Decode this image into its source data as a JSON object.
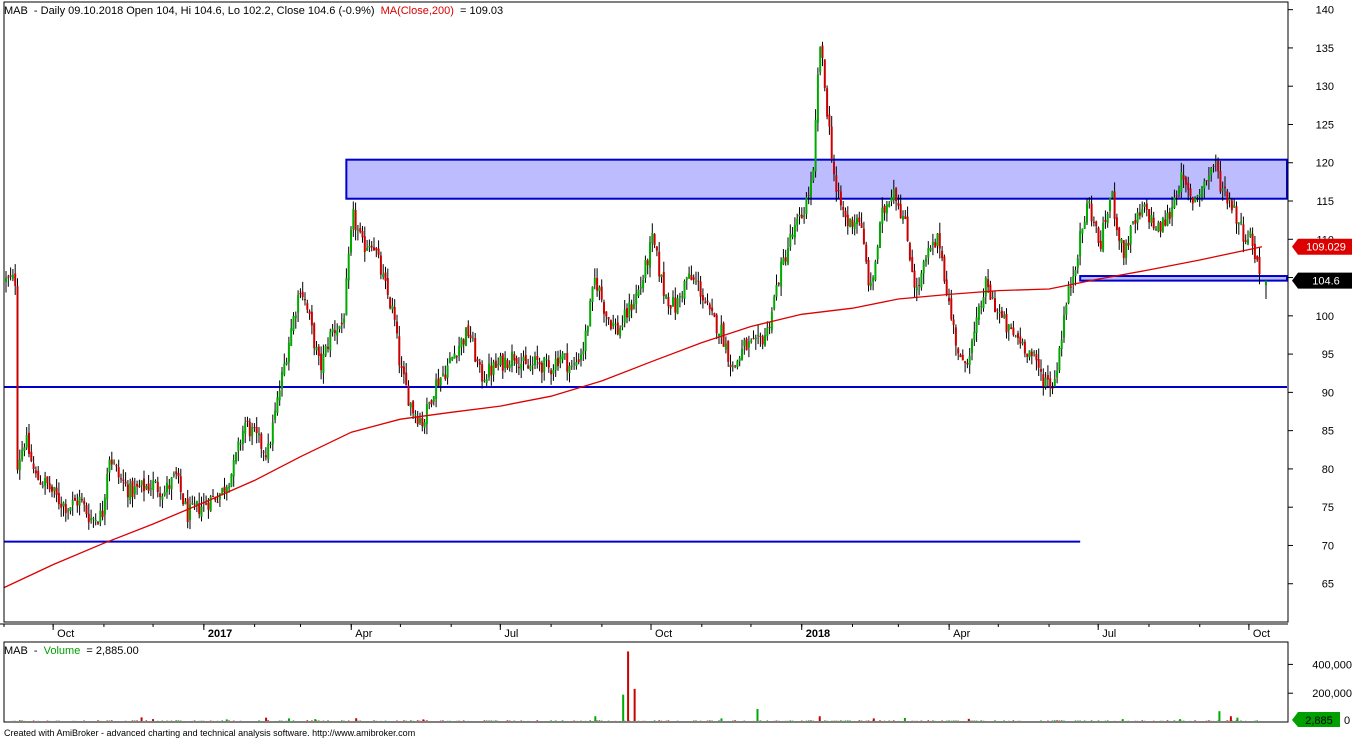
{
  "header": {
    "symbol": "MAB",
    "title_info": "- Daily 09.10.2018 Open 104, Hi 104.6, Lo 102.2, Close 104.6 (-0.9%)",
    "ma_label": "MA(Close,200)",
    "ma_value": "= 109.03"
  },
  "volume_header": {
    "symbol": "MAB",
    "dash": "-",
    "label": "Volume",
    "value": "= 2,885.00"
  },
  "footer": "Created with AmiBroker - advanced charting and technical analysis software. http://www.amibroker.com",
  "colors": {
    "up": "#00aa00",
    "down": "#cc0000",
    "wick": "#000000",
    "ma": "#dd0000",
    "level": "#0000cc",
    "zone_fill": "#b8b8ff",
    "volume_label": "#00a000"
  },
  "chart_data": [
    {
      "type": "candlestick",
      "symbol": "MAB",
      "period": "Daily",
      "last_bar": {
        "date": "09.10.2018",
        "open": 104,
        "high": 104.6,
        "low": 102.2,
        "close": 104.6,
        "change_pct": -0.9
      },
      "y_axis": {
        "range": [
          60,
          141
        ],
        "ticks": [
          65,
          70,
          75,
          80,
          85,
          90,
          95,
          100,
          105,
          110,
          115,
          120,
          125,
          130,
          135,
          140
        ]
      },
      "x_axis": {
        "labels": [
          "Oct",
          "2017",
          "Apr",
          "Jul",
          "Oct",
          "2018",
          "Apr",
          "Jul",
          "Oct"
        ],
        "bold": [
          "2017",
          "2018"
        ]
      },
      "close_path": [
        [
          "2016-09-08",
          80
        ],
        [
          "2016-09-14",
          84
        ],
        [
          "2016-09-20",
          79
        ],
        [
          "2016-09-27",
          78
        ],
        [
          "2016-10-04",
          76
        ],
        [
          "2016-10-10",
          75
        ],
        [
          "2016-10-17",
          76
        ],
        [
          "2016-10-24",
          73.5
        ],
        [
          "2016-10-31",
          74
        ],
        [
          "2016-11-04",
          82
        ],
        [
          "2016-11-10",
          79
        ],
        [
          "2016-11-17",
          77
        ],
        [
          "2016-11-24",
          77.5
        ],
        [
          "2016-12-01",
          78
        ],
        [
          "2016-12-08",
          77
        ],
        [
          "2016-12-15",
          79
        ],
        [
          "2016-12-22",
          74
        ],
        [
          "2016-12-29",
          75
        ],
        [
          "2017-01-05",
          76
        ],
        [
          "2017-01-12",
          77
        ],
        [
          "2017-01-19",
          80
        ],
        [
          "2017-01-26",
          86
        ],
        [
          "2017-02-02",
          84
        ],
        [
          "2017-02-09",
          82
        ],
        [
          "2017-02-16",
          90
        ],
        [
          "2017-02-23",
          98
        ],
        [
          "2017-03-01",
          104
        ],
        [
          "2017-03-06",
          100
        ],
        [
          "2017-03-13",
          93
        ],
        [
          "2017-03-20",
          98
        ],
        [
          "2017-03-27",
          99
        ],
        [
          "2017-04-02",
          113
        ],
        [
          "2017-04-08",
          109
        ],
        [
          "2017-04-14",
          110
        ],
        [
          "2017-04-20",
          105
        ],
        [
          "2017-04-27",
          100
        ],
        [
          "2017-05-01",
          93
        ],
        [
          "2017-05-08",
          88
        ],
        [
          "2017-05-15",
          86
        ],
        [
          "2017-05-22",
          91
        ],
        [
          "2017-05-29",
          93
        ],
        [
          "2017-06-05",
          96
        ],
        [
          "2017-06-12",
          98
        ],
        [
          "2017-06-19",
          92
        ],
        [
          "2017-06-26",
          93
        ],
        [
          "2017-07-03",
          94
        ],
        [
          "2017-07-10",
          95
        ],
        [
          "2017-07-17",
          93
        ],
        [
          "2017-07-24",
          94
        ],
        [
          "2017-07-31",
          93
        ],
        [
          "2017-08-07",
          95
        ],
        [
          "2017-08-14",
          93
        ],
        [
          "2017-08-21",
          96
        ],
        [
          "2017-08-28",
          105
        ],
        [
          "2017-09-04",
          100
        ],
        [
          "2017-09-11",
          98
        ],
        [
          "2017-09-18",
          101
        ],
        [
          "2017-09-25",
          104
        ],
        [
          "2017-10-02",
          110
        ],
        [
          "2017-10-09",
          103
        ],
        [
          "2017-10-16",
          101
        ],
        [
          "2017-10-23",
          105
        ],
        [
          "2017-10-30",
          104
        ],
        [
          "2017-11-06",
          100
        ],
        [
          "2017-11-13",
          98
        ],
        [
          "2017-11-20",
          93
        ],
        [
          "2017-11-27",
          96
        ],
        [
          "2017-12-04",
          96
        ],
        [
          "2017-12-11",
          98
        ],
        [
          "2017-12-18",
          105
        ],
        [
          "2017-12-25",
          110
        ],
        [
          "2018-01-01",
          113
        ],
        [
          "2018-01-08",
          118
        ],
        [
          "2018-01-12",
          136
        ],
        [
          "2018-01-16",
          128
        ],
        [
          "2018-01-22",
          116
        ],
        [
          "2018-01-29",
          112
        ],
        [
          "2018-02-05",
          113
        ],
        [
          "2018-02-12",
          103
        ],
        [
          "2018-02-19",
          113
        ],
        [
          "2018-02-26",
          117
        ],
        [
          "2018-03-05",
          112
        ],
        [
          "2018-03-12",
          103
        ],
        [
          "2018-03-19",
          108
        ],
        [
          "2018-03-26",
          110
        ],
        [
          "2018-04-02",
          100
        ],
        [
          "2018-04-09",
          93
        ],
        [
          "2018-04-16",
          97
        ],
        [
          "2018-04-23",
          104
        ],
        [
          "2018-04-30",
          101
        ],
        [
          "2018-05-07",
          98
        ],
        [
          "2018-05-14",
          97
        ],
        [
          "2018-05-21",
          95
        ],
        [
          "2018-05-28",
          92
        ],
        [
          "2018-06-04",
          91
        ],
        [
          "2018-06-11",
          101
        ],
        [
          "2018-06-18",
          108
        ],
        [
          "2018-06-25",
          115
        ],
        [
          "2018-07-02",
          109
        ],
        [
          "2018-07-09",
          116
        ],
        [
          "2018-07-16",
          108
        ],
        [
          "2018-07-23",
          112
        ],
        [
          "2018-07-30",
          114
        ],
        [
          "2018-08-06",
          111
        ],
        [
          "2018-08-13",
          113
        ],
        [
          "2018-08-20",
          118
        ],
        [
          "2018-08-27",
          115
        ],
        [
          "2018-09-03",
          117
        ],
        [
          "2018-09-10",
          120
        ],
        [
          "2018-09-14",
          117
        ],
        [
          "2018-09-20",
          115
        ],
        [
          "2018-09-27",
          111
        ],
        [
          "2018-10-03",
          110
        ],
        [
          "2018-10-08",
          105
        ],
        [
          "2018-10-09",
          104.6
        ]
      ],
      "series": [
        {
          "name": "MA(Close,200)",
          "type": "line",
          "last_value": 109.03,
          "points": [
            [
              "2016-09-01",
              64.5
            ],
            [
              "2016-10-01",
              67.5
            ],
            [
              "2016-11-01",
              70.3
            ],
            [
              "2016-12-01",
              72.8
            ],
            [
              "2017-01-01",
              75.6
            ],
            [
              "2017-02-01",
              78.5
            ],
            [
              "2017-03-01",
              81.6
            ],
            [
              "2017-04-01",
              84.8
            ],
            [
              "2017-05-01",
              86.5
            ],
            [
              "2017-06-01",
              87.4
            ],
            [
              "2017-07-01",
              88.2
            ],
            [
              "2017-08-01",
              89.5
            ],
            [
              "2017-09-01",
              91.5
            ],
            [
              "2017-10-01",
              94.0
            ],
            [
              "2017-11-01",
              96.5
            ],
            [
              "2017-12-01",
              98.6
            ],
            [
              "2018-01-01",
              100.2
            ],
            [
              "2018-02-01",
              101.0
            ],
            [
              "2018-03-01",
              102.2
            ],
            [
              "2018-04-01",
              102.8
            ],
            [
              "2018-05-01",
              103.3
            ],
            [
              "2018-06-01",
              103.5
            ],
            [
              "2018-07-01",
              104.8
            ],
            [
              "2018-08-01",
              106.0
            ],
            [
              "2018-09-01",
              107.3
            ],
            [
              "2018-10-09",
              109.03
            ]
          ]
        }
      ],
      "price_tags": [
        {
          "label": "109.029",
          "value": 109.03,
          "color": "#dd0000"
        },
        {
          "label": "104.6",
          "value": 104.6,
          "color": "#000000"
        }
      ],
      "annotations": [
        {
          "type": "zone",
          "from": "2017-03-29",
          "to": "2018-10-09",
          "bottom": 115.3,
          "top": 120.4
        },
        {
          "type": "zone",
          "from": "2018-06-20",
          "to": "2018-10-09",
          "bottom": 104.6,
          "top": 105.2
        },
        {
          "type": "hline",
          "value": 90.7,
          "from": "2016-09-01",
          "to": "2018-10-09"
        },
        {
          "type": "hline",
          "value": 70.5,
          "from": "2016-09-01",
          "to": "2018-06-20"
        }
      ]
    },
    {
      "type": "bar",
      "name": "Volume",
      "y_axis": {
        "range": [
          0,
          500000
        ],
        "ticks": [
          {
            "value": 200000,
            "label": "200,000"
          },
          {
            "value": 400000,
            "label": "400,000"
          }
        ]
      },
      "last_value": 2885,
      "last_value_label": "2,885",
      "baseline": 8000,
      "spikes": [
        [
          "2016-11-24",
          32000,
          "down"
        ],
        [
          "2016-12-01",
          20000,
          "down"
        ],
        [
          "2017-01-15",
          18000,
          "up"
        ],
        [
          "2017-02-08",
          30000,
          "down"
        ],
        [
          "2017-02-22",
          25000,
          "up"
        ],
        [
          "2017-03-10",
          20000,
          "up"
        ],
        [
          "2017-04-04",
          26000,
          "down"
        ],
        [
          "2017-05-15",
          18000,
          "down"
        ],
        [
          "2017-08-28",
          40000,
          "up"
        ],
        [
          "2017-09-14",
          190000,
          "up"
        ],
        [
          "2017-09-17",
          490000,
          "down"
        ],
        [
          "2017-09-21",
          230000,
          "down"
        ],
        [
          "2017-11-13",
          25000,
          "up"
        ],
        [
          "2017-12-05",
          90000,
          "up"
        ],
        [
          "2018-01-12",
          40000,
          "down"
        ],
        [
          "2018-02-14",
          25000,
          "down"
        ],
        [
          "2018-03-05",
          28000,
          "up"
        ],
        [
          "2018-04-13",
          22000,
          "down"
        ],
        [
          "2018-07-16",
          20000,
          "up"
        ],
        [
          "2018-08-20",
          20000,
          "up"
        ],
        [
          "2018-09-13",
          75000,
          "up"
        ],
        [
          "2018-09-20",
          40000,
          "down"
        ],
        [
          "2018-09-24",
          30000,
          "up"
        ]
      ]
    }
  ]
}
